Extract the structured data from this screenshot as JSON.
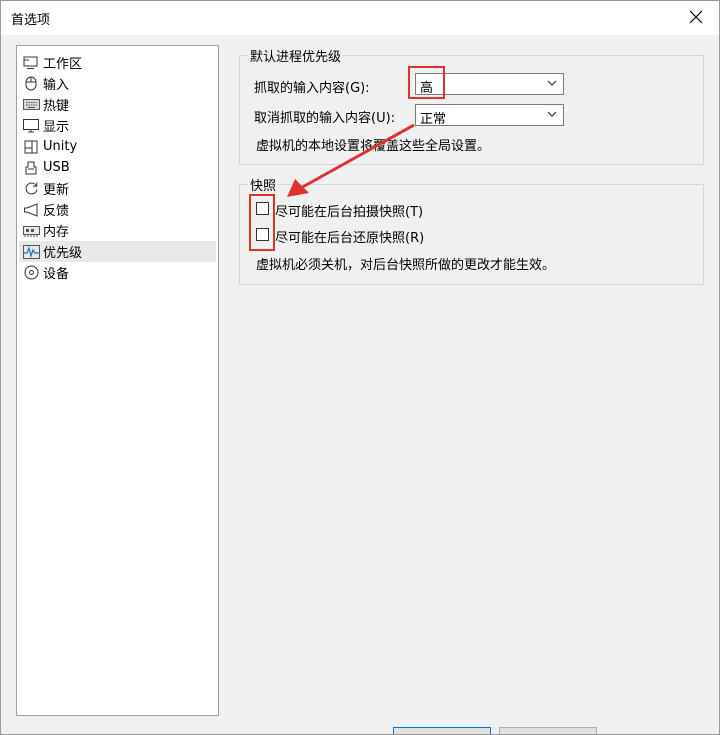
{
  "window": {
    "title": "首选项"
  },
  "sidebar": {
    "items": [
      {
        "label": "工作区",
        "icon": "workspace-icon"
      },
      {
        "label": "输入",
        "icon": "mouse-icon"
      },
      {
        "label": "热键",
        "icon": "keyboard-icon"
      },
      {
        "label": "显示",
        "icon": "monitor-icon"
      },
      {
        "label": "Unity",
        "icon": "unity-icon"
      },
      {
        "label": "USB",
        "icon": "usb-icon"
      },
      {
        "label": "更新",
        "icon": "refresh-icon"
      },
      {
        "label": "反馈",
        "icon": "megaphone-icon"
      },
      {
        "label": "内存",
        "icon": "memory-icon"
      },
      {
        "label": "优先级",
        "icon": "activity-icon"
      },
      {
        "label": "设备",
        "icon": "disc-icon"
      }
    ],
    "selected_label": "优先级"
  },
  "priority_group": {
    "title": "默认进程优先级",
    "grab_label": "抓取的输入内容(G):",
    "grab_value": "高",
    "ungrab_label": "取消抓取的输入内容(U):",
    "ungrab_value": "正常",
    "note": "虚拟机的本地设置将覆盖这些全局设置。"
  },
  "snapshot_group": {
    "title": "快照",
    "option1_label": "尽可能在后台拍摄快照(T)",
    "option1_checked": false,
    "option2_label": "尽可能在后台还原快照(R)",
    "option2_checked": false,
    "note": "虚拟机必须关机，对后台快照所做的更改才能生效。"
  },
  "annotation": {
    "color": "#e03131"
  }
}
